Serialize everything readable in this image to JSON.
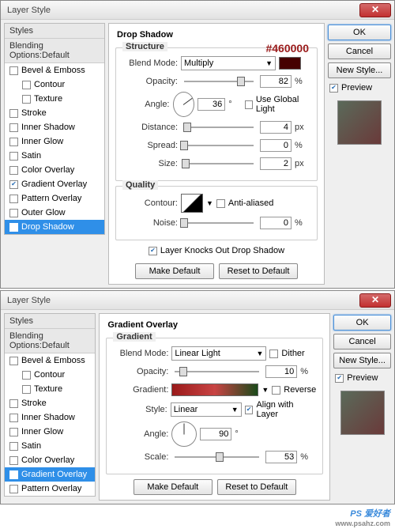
{
  "dialog1": {
    "title": "Layer Style",
    "hex": "#460000",
    "sidebar": {
      "head": "Styles",
      "subhead": "Blending Options:Default",
      "items": [
        {
          "label": "Bevel & Emboss",
          "checked": false,
          "indent": false
        },
        {
          "label": "Contour",
          "checked": false,
          "indent": true
        },
        {
          "label": "Texture",
          "checked": false,
          "indent": true
        },
        {
          "label": "Stroke",
          "checked": false,
          "indent": false
        },
        {
          "label": "Inner Shadow",
          "checked": false,
          "indent": false
        },
        {
          "label": "Inner Glow",
          "checked": false,
          "indent": false
        },
        {
          "label": "Satin",
          "checked": false,
          "indent": false
        },
        {
          "label": "Color Overlay",
          "checked": false,
          "indent": false
        },
        {
          "label": "Gradient Overlay",
          "checked": true,
          "indent": false
        },
        {
          "label": "Pattern Overlay",
          "checked": false,
          "indent": false
        },
        {
          "label": "Outer Glow",
          "checked": false,
          "indent": false
        },
        {
          "label": "Drop Shadow",
          "checked": true,
          "indent": false,
          "selected": true
        }
      ]
    },
    "center": {
      "title": "Drop Shadow",
      "structure": {
        "title": "Structure",
        "blendmode_lbl": "Blend Mode:",
        "blendmode": "Multiply",
        "opacity_lbl": "Opacity:",
        "opacity": "82",
        "opacity_unit": "%",
        "angle_lbl": "Angle:",
        "angle": "36",
        "angle_unit": "°",
        "global_lbl": "Use Global Light",
        "global": false,
        "distance_lbl": "Distance:",
        "distance": "4",
        "distance_unit": "px",
        "spread_lbl": "Spread:",
        "spread": "0",
        "spread_unit": "%",
        "size_lbl": "Size:",
        "size": "2",
        "size_unit": "px"
      },
      "quality": {
        "title": "Quality",
        "contour_lbl": "Contour:",
        "aa_lbl": "Anti-aliased",
        "aa": false,
        "noise_lbl": "Noise:",
        "noise": "0",
        "noise_unit": "%"
      },
      "knocks_lbl": "Layer Knocks Out Drop Shadow",
      "knocks": true,
      "make_default": "Make Default",
      "reset_default": "Reset to Default"
    },
    "right": {
      "ok": "OK",
      "cancel": "Cancel",
      "newstyle": "New Style...",
      "preview_lbl": "Preview",
      "preview": true
    }
  },
  "dialog2": {
    "title": "Layer Style",
    "sidebar": {
      "head": "Styles",
      "subhead": "Blending Options:Default",
      "items": [
        {
          "label": "Bevel & Emboss",
          "checked": false,
          "indent": false
        },
        {
          "label": "Contour",
          "checked": false,
          "indent": true
        },
        {
          "label": "Texture",
          "checked": false,
          "indent": true
        },
        {
          "label": "Stroke",
          "checked": false,
          "indent": false
        },
        {
          "label": "Inner Shadow",
          "checked": false,
          "indent": false
        },
        {
          "label": "Inner Glow",
          "checked": false,
          "indent": false
        },
        {
          "label": "Satin",
          "checked": false,
          "indent": false
        },
        {
          "label": "Color Overlay",
          "checked": false,
          "indent": false
        },
        {
          "label": "Gradient Overlay",
          "checked": true,
          "indent": false,
          "selected": true
        },
        {
          "label": "Pattern Overlay",
          "checked": false,
          "indent": false
        }
      ]
    },
    "center": {
      "title": "Gradient Overlay",
      "gradient": {
        "title": "Gradient",
        "blendmode_lbl": "Blend Mode:",
        "blendmode": "Linear Light",
        "dither_lbl": "Dither",
        "dither": false,
        "opacity_lbl": "Opacity:",
        "opacity": "10",
        "opacity_unit": "%",
        "gradient_lbl": "Gradient:",
        "reverse_lbl": "Reverse",
        "reverse": false,
        "style_lbl": "Style:",
        "style": "Linear",
        "align_lbl": "Align with Layer",
        "align": true,
        "angle_lbl": "Angle:",
        "angle": "90",
        "angle_unit": "°",
        "scale_lbl": "Scale:",
        "scale": "53",
        "scale_unit": "%"
      },
      "make_default": "Make Default",
      "reset_default": "Reset to Default"
    },
    "right": {
      "ok": "OK",
      "cancel": "Cancel",
      "newstyle": "New Style...",
      "preview_lbl": "Preview",
      "preview": true
    }
  },
  "watermark": {
    "main": "PS 爱好者",
    "sub": "www.psahz.com"
  }
}
